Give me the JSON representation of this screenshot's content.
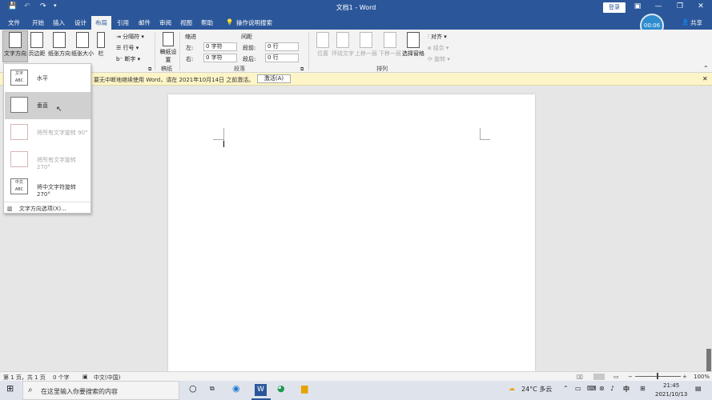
{
  "titlebar": {
    "title": "文档1 - Word",
    "login": "登录",
    "qat": [
      "💾",
      "↶",
      "↷",
      "▾"
    ]
  },
  "tabs": [
    "文件",
    "开始",
    "插入",
    "设计",
    "布局",
    "引用",
    "邮件",
    "审阅",
    "视图",
    "帮助",
    "操作说明搜索"
  ],
  "active_tab": "布局",
  "share": "共享",
  "timer": "00:06",
  "ribbon": {
    "text_direction": "文字方向",
    "margins": "页边距",
    "orientation": "纸张方向",
    "size": "纸张大小",
    "columns": "栏",
    "breaks": "分隔符",
    "line_numbers": "行号",
    "hyphenation": "断字",
    "draft_paper": "稿纸设置",
    "draft_group": "稿纸",
    "indent_header": "缩进",
    "spacing_header": "间距",
    "indent_left_label": "左:",
    "indent_left_value": "0 字符",
    "indent_right_label": "右:",
    "indent_right_value": "0 字符",
    "spacing_before_label": "段前:",
    "spacing_before_value": "0 行",
    "spacing_after_label": "段后:",
    "spacing_after_value": "0 行",
    "paragraph_group": "段落",
    "position": "位置",
    "wrap_text": "环绕文字",
    "bring_forward": "上移一层",
    "send_backward": "下移一层",
    "selection_pane": "选择窗格",
    "align": "对齐",
    "group": "组合",
    "rotate": "旋转",
    "arrange_group": "排列"
  },
  "notice": {
    "message": "要无中断地继续使用 Word，请在 2021年10月14日 之前激活。",
    "activate": "激活(A)"
  },
  "dropdown": {
    "items": [
      {
        "label": "水平",
        "icon_text": "文字 ABC",
        "disabled": false
      },
      {
        "label": "垂直",
        "icon_text": "",
        "disabled": false
      },
      {
        "label": "将所有文字旋转 90°",
        "icon_text": "",
        "disabled": true
      },
      {
        "label": "将所有文字旋转 270°",
        "icon_text": "",
        "disabled": true
      },
      {
        "label": "将中文字符旋转 270°",
        "icon_text": "中文 ABC",
        "disabled": false
      }
    ],
    "options": "文字方向选项(X)..."
  },
  "status": {
    "page": "第 1 页，共 1 页",
    "words": "0 个字",
    "lang": "中文(中国)",
    "zoom": "100%"
  },
  "taskbar": {
    "search_placeholder": "在这里输入你要搜索的内容",
    "weather": "24°C 多云",
    "time": "21:45",
    "date": "2021/10/13"
  }
}
